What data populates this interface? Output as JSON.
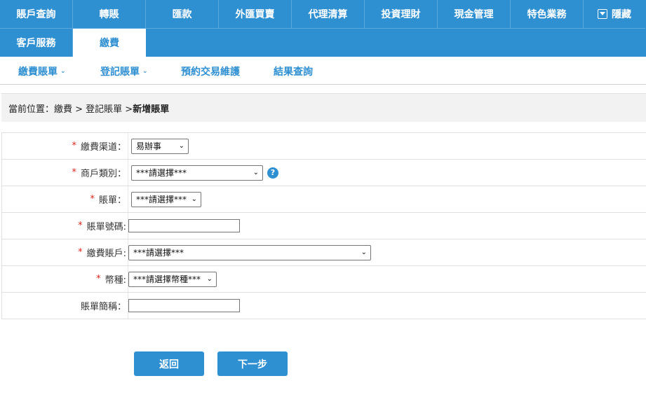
{
  "nav": {
    "row1": [
      "賬戶查詢",
      "轉賬",
      "匯款",
      "外匯買賣",
      "代理清算",
      "投資理財",
      "現金管理",
      "特色業務"
    ],
    "hide_label": "隱藏",
    "row2": [
      "客戶服務",
      "繳費"
    ]
  },
  "subnav": {
    "items": [
      "繳費賬單",
      "登記賬單",
      "預約交易維護",
      "結果查詢"
    ]
  },
  "breadcrumb": {
    "prefix": "當前位置：繳費 > 登記賬單 > ",
    "current": "新增賬單"
  },
  "form": {
    "channel_label": "繳費渠道：",
    "channel_value": "易辦事",
    "merchant_label": "商戶類別：",
    "merchant_value": "***請選擇***",
    "help_symbol": "?",
    "bill_label": "賬單：",
    "bill_value": "***請選擇***",
    "bill_no_label": "賬單號碼:",
    "bill_no_value": "",
    "account_label": "繳費賬戶:",
    "account_value": "***請選擇***",
    "currency_label": "幣種:",
    "currency_value": "***請選擇幣種***",
    "short_name_label": "賬單簡稱：",
    "short_name_value": "",
    "required_mark": "*"
  },
  "buttons": {
    "back": "返回",
    "next": "下一步"
  },
  "colors": {
    "brand": "#2e8fd1",
    "required": "#d9271c"
  }
}
